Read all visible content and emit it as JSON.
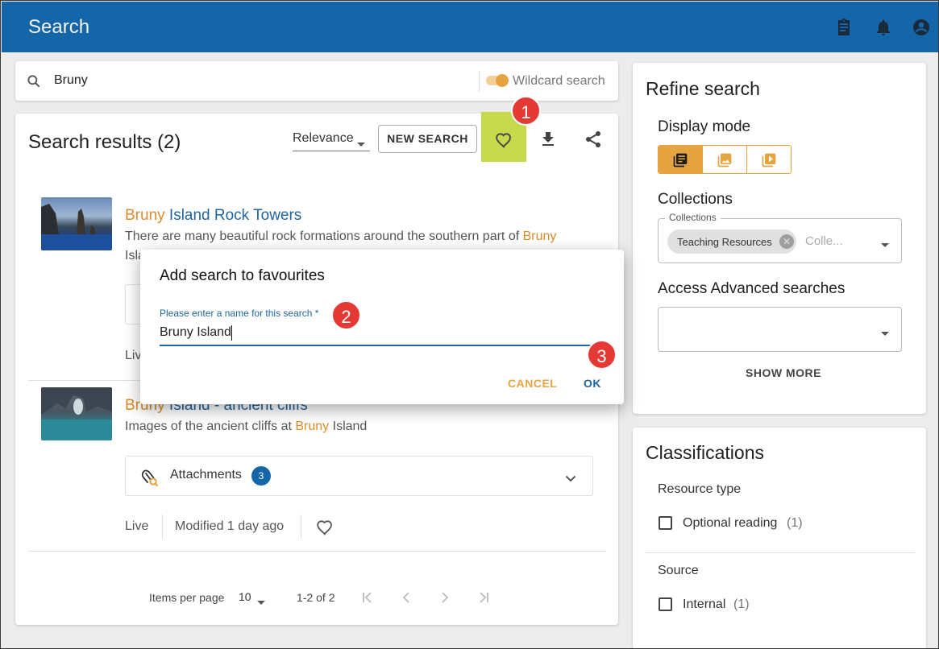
{
  "app": {
    "title": "Search"
  },
  "search": {
    "value": "Bruny",
    "wildcard_label": "Wildcard search"
  },
  "results": {
    "heading": "Search results (2)",
    "sort": "Relevance",
    "new_search": "NEW SEARCH",
    "items": [
      {
        "title_highlight": "Bruny",
        "title_rest": " Island Rock Towers",
        "desc_before": "There are many beautiful rock formations around the southern part of ",
        "desc_highlight": "Bruny",
        "desc_line2": "Isla"
      },
      {
        "title_highlight": "Bruny",
        "title_rest": " Island - ancient cliffs",
        "desc_before": "Images of the ancient cliffs at ",
        "desc_highlight": "Bruny",
        "desc_after": " Island",
        "attachments_label": "Attachments",
        "attachments_count": "3",
        "status": "Live",
        "modified": "Modified 1 day ago"
      }
    ],
    "item1_status": "Live",
    "pagination": {
      "items_per_page_label": "Items per page",
      "items_per_page": "10",
      "range": "1-2 of 2"
    }
  },
  "refine": {
    "heading": "Refine search",
    "display_mode": "Display mode",
    "collections_heading": "Collections",
    "collections_field_label": "Collections",
    "collections_chip": "Teaching Resources",
    "collections_placeholder": "Colle...",
    "advanced_heading": "Access Advanced searches",
    "show_more": "SHOW MORE"
  },
  "classifications": {
    "heading": "Classifications",
    "groups": [
      {
        "title": "Resource type",
        "option": "Optional reading",
        "count": "(1)"
      },
      {
        "title": "Source",
        "option": "Internal",
        "count": "(1)"
      }
    ]
  },
  "dialog": {
    "title": "Add search to favourites",
    "field_label": "Please enter a name for this search *",
    "field_value": "Bruny Island",
    "cancel": "CANCEL",
    "ok": "OK"
  },
  "callouts": [
    "1",
    "2",
    "3"
  ],
  "colors": {
    "appbar": "#1466a8",
    "accent": "#e5a440",
    "highlight": "#c6d94a",
    "callout": "#e53935",
    "link": "#1f65a0"
  }
}
